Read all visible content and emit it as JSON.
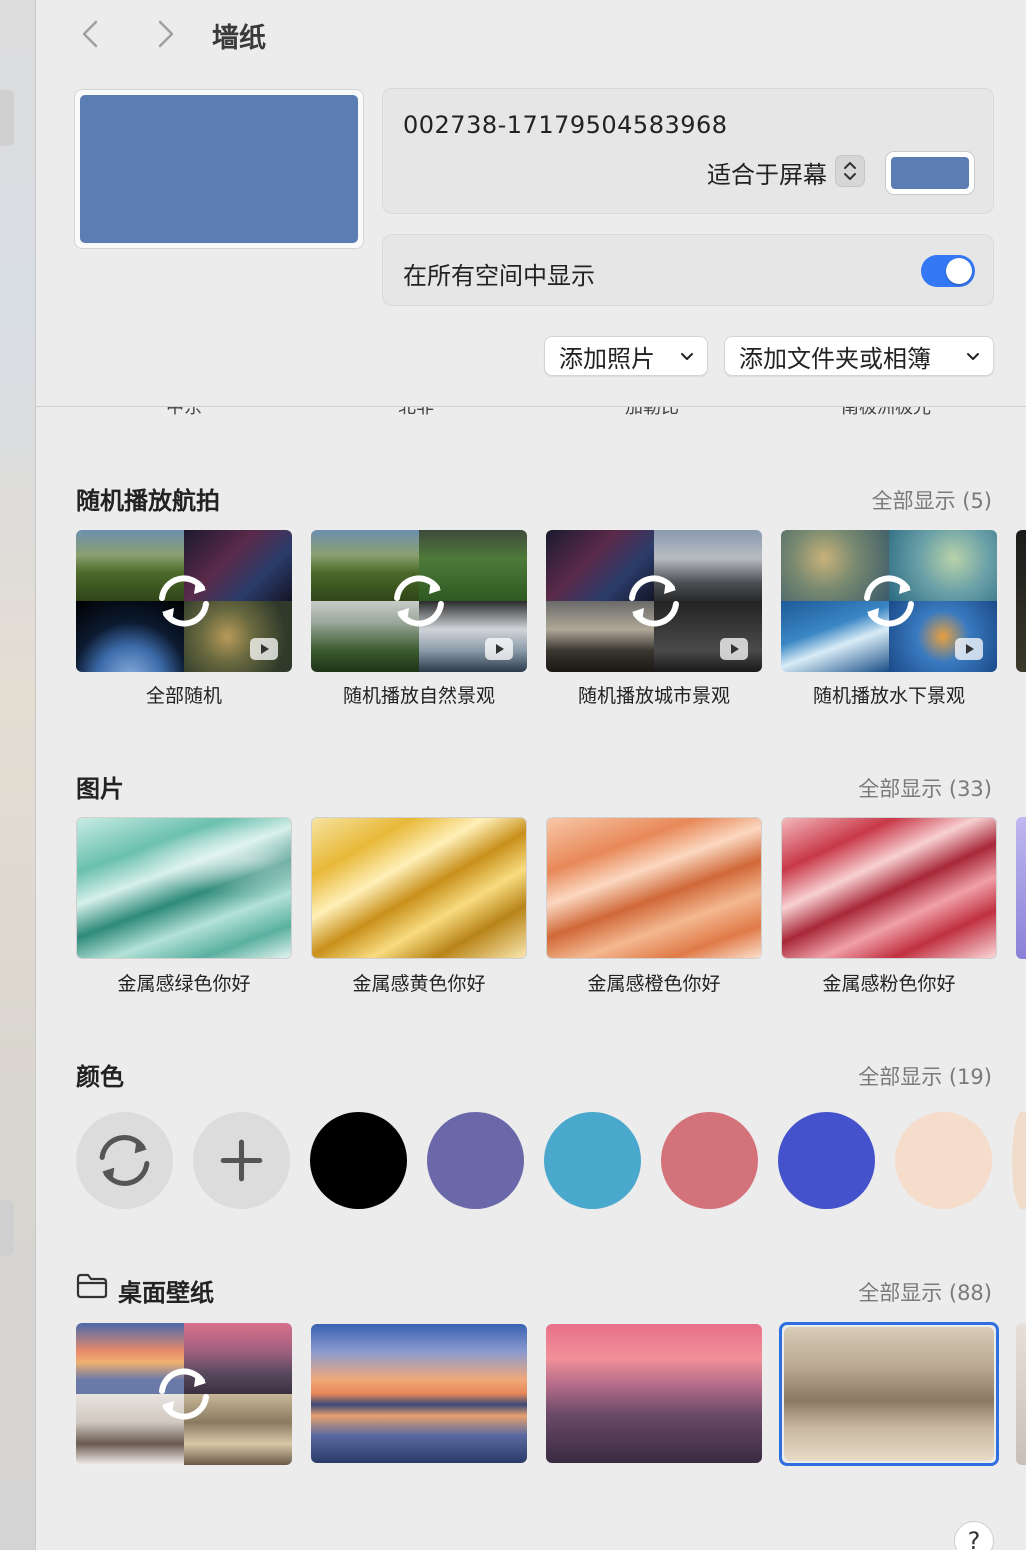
{
  "header": {
    "title": "墙纸",
    "back_icon": "chevron-left-icon",
    "forward_icon": "chevron-right-icon"
  },
  "current": {
    "name": "002738-17179504583968",
    "fit_mode": "适合于屏幕",
    "color": "#5b7db4",
    "show_on_all_spaces_label": "在所有空间中显示",
    "show_on_all_spaces": true
  },
  "buttons": {
    "add_photo": "添加照片",
    "add_folder": "添加文件夹或相簿"
  },
  "cut_off_labels": [
    "中东",
    "北非",
    "加勒比",
    "南极洲极光"
  ],
  "aerials": {
    "title": "随机播放航拍",
    "show_all": "全部显示 (5)",
    "items": [
      {
        "label": "全部随机"
      },
      {
        "label": "随机播放自然景观"
      },
      {
        "label": "随机播放城市景观"
      },
      {
        "label": "随机播放水下景观"
      }
    ]
  },
  "pictures": {
    "title": "图片",
    "show_all": "全部显示 (33)",
    "items": [
      {
        "label": "金属感绿色你好"
      },
      {
        "label": "金属感黄色你好"
      },
      {
        "label": "金属感橙色你好"
      },
      {
        "label": "金属感粉色你好"
      }
    ]
  },
  "colors": {
    "title": "颜色",
    "show_all": "全部显示 (19)",
    "shuffle_icon": "shuffle-icon",
    "add_icon": "plus-icon",
    "swatches": [
      "#000000",
      "#6a68a8",
      "#4aa8cc",
      "#d4727a",
      "#4452cc",
      "#f6dccb"
    ]
  },
  "desktop": {
    "title": "桌面壁纸",
    "show_all": "全部显示 (88)",
    "folder_icon": "folder-icon"
  },
  "help": {
    "label": "?"
  }
}
